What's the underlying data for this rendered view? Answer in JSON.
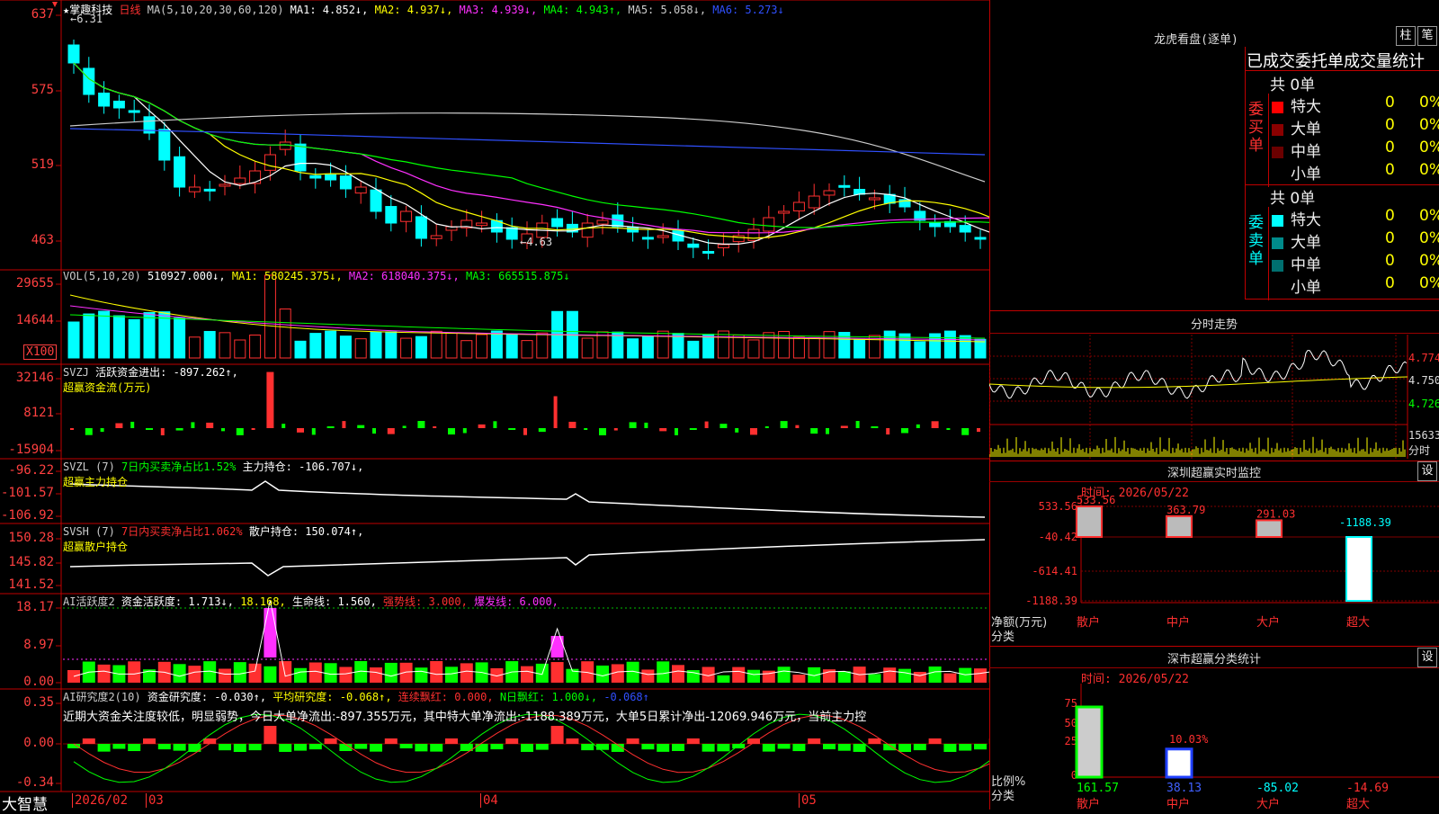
{
  "logo": "大智慧",
  "price_panel": {
    "title": "★掌趣科技",
    "period": "日线",
    "ma_header": "MA(5,10,20,30,60,120)",
    "ma": [
      {
        "label": "MA1: 4.852↓,",
        "color": "#ffffff"
      },
      {
        "label": "MA2: 4.937↓,",
        "color": "#ffff00"
      },
      {
        "label": "MA3: 4.939↓,",
        "color": "#ff30ff"
      },
      {
        "label": "MA4: 4.943↑,",
        "color": "#00ff00"
      },
      {
        "label": "MA5: 5.058↓,",
        "color": "#cccccc"
      },
      {
        "label": "MA6: 5.273↓",
        "color": "#3050ff"
      }
    ],
    "yticks": [
      "637",
      "575",
      "519",
      "463"
    ],
    "high_label": "6.31",
    "low_label": "4.63"
  },
  "vol_panel": {
    "header": "VOL(5,10,20)",
    "value": "510927.000↓,",
    "ma": [
      {
        "label": "MA1: 580245.375↓,",
        "color": "#ffff00"
      },
      {
        "label": "MA2: 618040.375↓,",
        "color": "#ff30ff"
      },
      {
        "label": "MA3: 665515.875↓",
        "color": "#00ff00"
      }
    ],
    "yticks": [
      "29655",
      "14644"
    ],
    "unit": "X100"
  },
  "svzj_panel": {
    "line1_a": "SVZJ",
    "line1_b": "活跃资金进出: -897.262↑,",
    "line2": "超赢资金流(万元)",
    "yticks": [
      "32146",
      "8121",
      "-15904"
    ]
  },
  "svzl_panel": {
    "line1_a": "SVZL (7)",
    "line1_b": "7日内买卖净占比1.52%",
    "line1_c": "主力持仓: -106.707↓,",
    "line2": "超赢主力持仓",
    "yticks": [
      "-96.22",
      "-101.57",
      "-106.92"
    ]
  },
  "svsh_panel": {
    "line1_a": "SVSH (7)",
    "line1_b": "7日内买卖净占比1.062%",
    "line1_c": "散户持仓: 150.074↑,",
    "line2": "超赢散户持仓",
    "yticks": [
      "150.28",
      "145.82",
      "141.52"
    ]
  },
  "ai_active_panel": {
    "a": "AI活跃度2",
    "b": "资金活跃度: 1.713↓,",
    "c": "18.168,",
    "d": "生命线: 1.560,",
    "e": "强势线: 3.000,",
    "f": "爆发线: 6.000,",
    "yticks": [
      "18.17",
      "8.97",
      "0.00"
    ]
  },
  "ai_research_panel": {
    "a": "AI研究度2(10)",
    "b": "资金研究度: -0.030↑,",
    "c": "平均研究度: -0.068↑,",
    "d": "连续飘红: 0.000,",
    "e": "N日飘红: 1.000↓,",
    "f": "-0.068↑",
    "commentary": "近期大资金关注度较低，明显弱势，今日大单净流出:-897.355万元，其中特大单净流出:-1188.389万元，大单5日累计净出-12069.946万元，当前主力控",
    "yticks": [
      "0.35",
      "0.00",
      "-0.34"
    ]
  },
  "date_axis": [
    "2026/02",
    "03",
    "04",
    "05"
  ],
  "dragon_tiger": {
    "title": "龙虎看盘(逐单)",
    "btn1": "柱",
    "btn2": "笔",
    "subtitle": "已成交委托单成交量统计",
    "buy_side": "委买单",
    "sell_side": "委卖单",
    "buy_total": "共 0单",
    "sell_total": "共 0单",
    "buy_rows": [
      {
        "name": "特大",
        "count": "0",
        "pct": "0%",
        "color": "#ff0000"
      },
      {
        "name": "大单",
        "count": "0",
        "pct": "0%",
        "color": "#8b0000"
      },
      {
        "name": "中单",
        "count": "0",
        "pct": "0%",
        "color": "#6b0000"
      },
      {
        "name": "小单",
        "count": "0",
        "pct": "0%",
        "color": "#000000"
      }
    ],
    "sell_rows": [
      {
        "name": "特大",
        "count": "0",
        "pct": "0%",
        "color": "#00ffff"
      },
      {
        "name": "大单",
        "count": "0",
        "pct": "0%",
        "color": "#008b8b"
      },
      {
        "name": "中单",
        "count": "0",
        "pct": "0%",
        "color": "#007070"
      },
      {
        "name": "小单",
        "count": "0",
        "pct": "0%",
        "color": "#000000"
      }
    ]
  },
  "intraday": {
    "title": "分时走势",
    "yticks": [
      "4.774",
      "4.750",
      "4.726"
    ],
    "vol_label": "15633",
    "vol_unit": "分时"
  },
  "sz_monitor": {
    "title": "深圳超赢实时监控",
    "btn": "设",
    "time": "时间: 2026/05/22",
    "yticks": [
      "533.56",
      "-40.42",
      "-614.41",
      "-1188.39"
    ],
    "ylabel1": "净额(万元)",
    "ylabel2": "分类",
    "categories": [
      "散户",
      "中户",
      "大户",
      "超大"
    ],
    "values": [
      533.56,
      363.79,
      291.03,
      -1188.39
    ],
    "value_labels": [
      "533.56",
      "363.79",
      "291.03",
      "-1188.39"
    ]
  },
  "sz_classify": {
    "title": "深市超赢分类统计",
    "btn": "设",
    "time": "时间: 2026/05/22",
    "yticks": [
      "75",
      "50",
      "25",
      "0"
    ],
    "ylabel1": "比例%",
    "ylabel2": "分类",
    "pct_label": "10.03%",
    "categories": [
      "散户",
      "中户",
      "大户",
      "超大"
    ],
    "values": [
      "161.57",
      "38.13",
      "-85.02",
      "-14.69"
    ],
    "bars": [
      100,
      40,
      0,
      0
    ]
  }
}
